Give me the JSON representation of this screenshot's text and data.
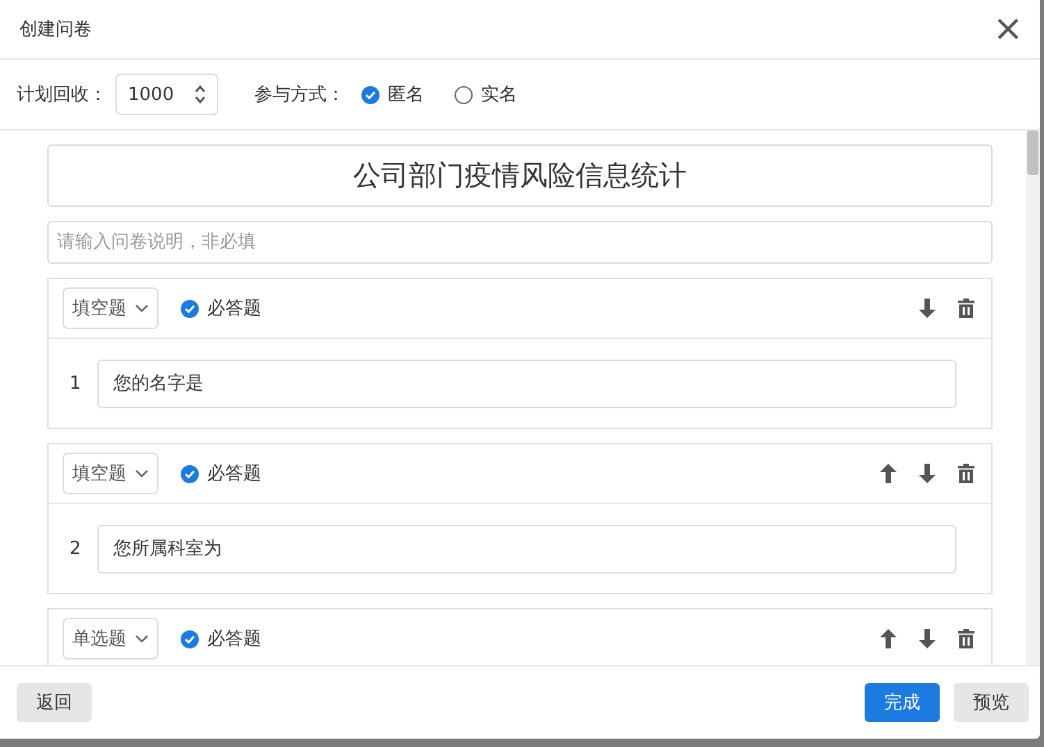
{
  "dialog": {
    "title": "创建问卷",
    "close": "×"
  },
  "settings": {
    "plan_label": "计划回收：",
    "plan_value": "1000",
    "mode_label": "参与方式：",
    "modes": [
      {
        "label": "匿名",
        "selected": true
      },
      {
        "label": "实名",
        "selected": false
      }
    ]
  },
  "survey": {
    "title": "公司部门疫情风险信息统计",
    "description_placeholder": "请输入问卷说明，非必填"
  },
  "questions": [
    {
      "type": "填空题",
      "required_label": "必答题",
      "required": true,
      "move_up": false,
      "move_down": true,
      "number": "1",
      "text": "您的名字是"
    },
    {
      "type": "填空题",
      "required_label": "必答题",
      "required": true,
      "move_up": true,
      "move_down": true,
      "number": "2",
      "text": "您所属科室为"
    },
    {
      "type": "单选题",
      "required_label": "必答题",
      "required": true,
      "move_up": true,
      "move_down": true
    }
  ],
  "footer": {
    "back": "返回",
    "done": "完成",
    "preview": "预览"
  }
}
